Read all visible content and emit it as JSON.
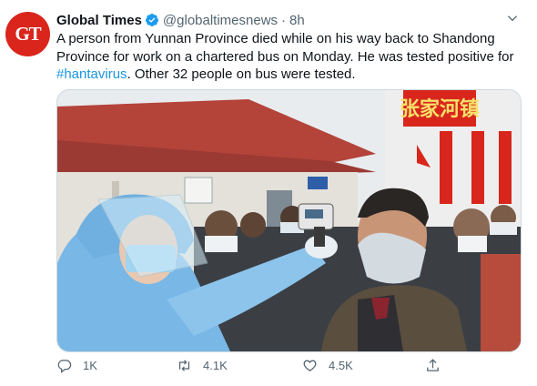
{
  "tweet": {
    "avatar_text": "GT",
    "display_name": "Global Times",
    "handle": "@globaltimesnews",
    "separator": "·",
    "time": "8h",
    "text_before": "A person from Yunnan Province died while on his way back to Shandong Province for work on a chartered bus on Monday. He was tested positive for ",
    "hashtag": "#hantavirus",
    "text_after": ". Other 32 people on bus were tested.",
    "media": {
      "sign_text": "张家河镇",
      "alt": "Health worker in protective gear checks a man's temperature at a bus stop"
    },
    "actions": {
      "reply_count": "1K",
      "retweet_count": "4.1K",
      "like_count": "4.5K"
    },
    "colors": {
      "accent": "#1b95e0",
      "brand_red": "#d9251c",
      "muted": "#536471"
    },
    "icons": [
      "verified-badge-icon",
      "chevron-down-icon",
      "reply-icon",
      "retweet-icon",
      "like-icon",
      "share-icon"
    ]
  }
}
